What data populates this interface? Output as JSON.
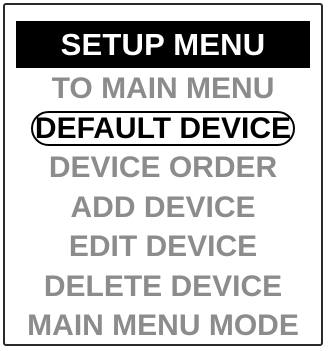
{
  "title": "SETUP MENU",
  "items": [
    {
      "label": "TO MAIN MENU"
    },
    {
      "label": "DEFAULT DEVICE"
    },
    {
      "label": "DEVICE ORDER"
    },
    {
      "label": "ADD DEVICE"
    },
    {
      "label": "EDIT DEVICE"
    },
    {
      "label": "DELETE DEVICE"
    },
    {
      "label": "MAIN MENU MODE"
    }
  ],
  "selected_index": 1,
  "colors": {
    "title_bg": "#000000",
    "title_fg": "#ffffff",
    "item_fg": "#8c8c8c",
    "selected_fg": "#000000"
  }
}
